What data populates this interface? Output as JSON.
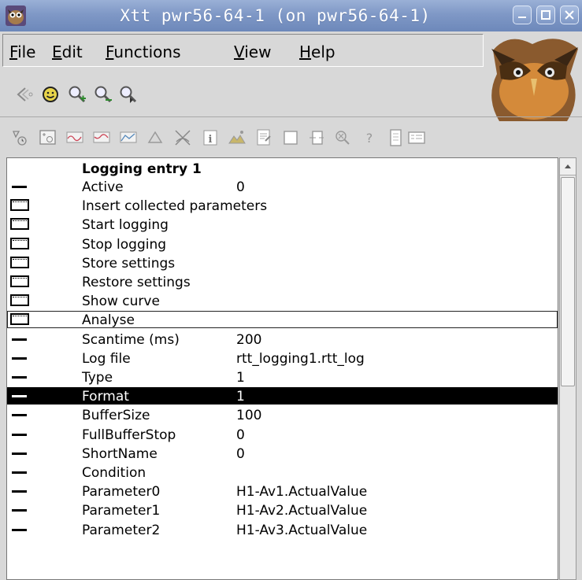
{
  "window": {
    "title": "Xtt pwr56-64-1 (on pwr56-64-1)"
  },
  "menu": [
    {
      "label": "File",
      "mnemonic": "F",
      "rest": "ile"
    },
    {
      "label": "Edit",
      "mnemonic": "E",
      "rest": "dit"
    },
    {
      "label": "Functions",
      "mnemonic": "F",
      "rest": "unctions"
    },
    {
      "label": "View",
      "mnemonic": "V",
      "rest": "iew"
    },
    {
      "label": "Help",
      "mnemonic": "H",
      "rest": "elp"
    }
  ],
  "toolbar1": [
    "back-icon",
    "smiley-icon",
    "zoom-in-icon",
    "zoom-out-icon",
    "zoom-reset-icon"
  ],
  "toolbar2": [
    "trace-icon",
    "graph-icon",
    "curve-icon",
    "curve2-icon",
    "chart-icon",
    "triangle-icon",
    "crossed-icon",
    "info-icon",
    "image-icon",
    "document-icon",
    "window-icon",
    "split-icon",
    "search-icon",
    "help-icon",
    "page-icon",
    "list-icon"
  ],
  "list": {
    "header": "Logging entry 1",
    "rows": [
      {
        "icon": "dash",
        "name": "Active",
        "value": "0"
      },
      {
        "icon": "button",
        "name": "Insert collected parameters",
        "value": ""
      },
      {
        "icon": "button",
        "name": "Start logging",
        "value": ""
      },
      {
        "icon": "button",
        "name": "Stop logging",
        "value": ""
      },
      {
        "icon": "button",
        "name": "Store settings",
        "value": ""
      },
      {
        "icon": "button",
        "name": "Restore settings",
        "value": ""
      },
      {
        "icon": "button",
        "name": "Show curve",
        "value": ""
      },
      {
        "icon": "button",
        "name": "Analyse",
        "value": ""
      },
      {
        "icon": "dash",
        "name": "Scantime (ms)",
        "value": "200"
      },
      {
        "icon": "dash",
        "name": "Log file",
        "value": "rtt_logging1.rtt_log"
      },
      {
        "icon": "dash",
        "name": "Type",
        "value": "1"
      },
      {
        "icon": "dash",
        "name": "Format",
        "value": "1"
      },
      {
        "icon": "dash",
        "name": "BufferSize",
        "value": "100"
      },
      {
        "icon": "dash",
        "name": "FullBufferStop",
        "value": "0"
      },
      {
        "icon": "dash",
        "name": "ShortName",
        "value": "0"
      },
      {
        "icon": "dash",
        "name": "Condition",
        "value": ""
      },
      {
        "icon": "dash",
        "name": "Parameter0",
        "value": "H1-Av1.ActualValue"
      },
      {
        "icon": "dash",
        "name": "Parameter1",
        "value": "H1-Av2.ActualValue"
      },
      {
        "icon": "dash",
        "name": "Parameter2",
        "value": "H1-Av3.ActualValue"
      }
    ],
    "selected_row": "Format",
    "outlined_row": "Analyse"
  },
  "colors": {
    "titlebar": "#7f98c6",
    "selection": "#000000",
    "list_bg": "#ffffff"
  }
}
